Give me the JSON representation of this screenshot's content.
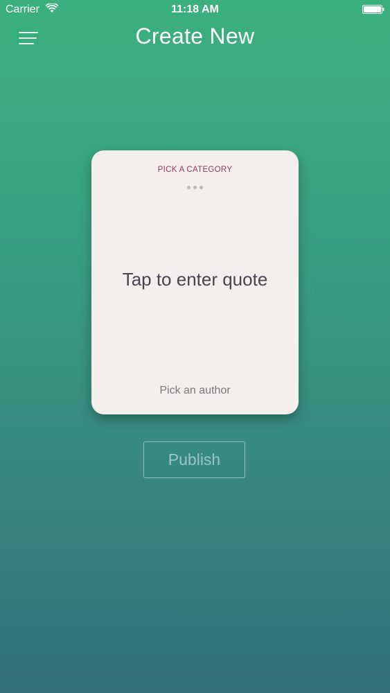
{
  "status_bar": {
    "carrier": "Carrier",
    "time": "11:18 AM",
    "wifi_icon": "wifi-icon",
    "battery_icon": "battery-full-icon"
  },
  "header": {
    "title": "Create New",
    "menu_icon": "hamburger-menu-icon"
  },
  "card": {
    "category": "PICK A CATEGORY",
    "quote_placeholder": "Tap to enter quote",
    "author_placeholder": "Pick an author"
  },
  "actions": {
    "publish_label": "Publish"
  },
  "colors": {
    "gradient_top": "#3bb07f",
    "gradient_bottom": "#346f7a",
    "card_background": "#f4efec",
    "category_accent": "#8b3a5c"
  }
}
